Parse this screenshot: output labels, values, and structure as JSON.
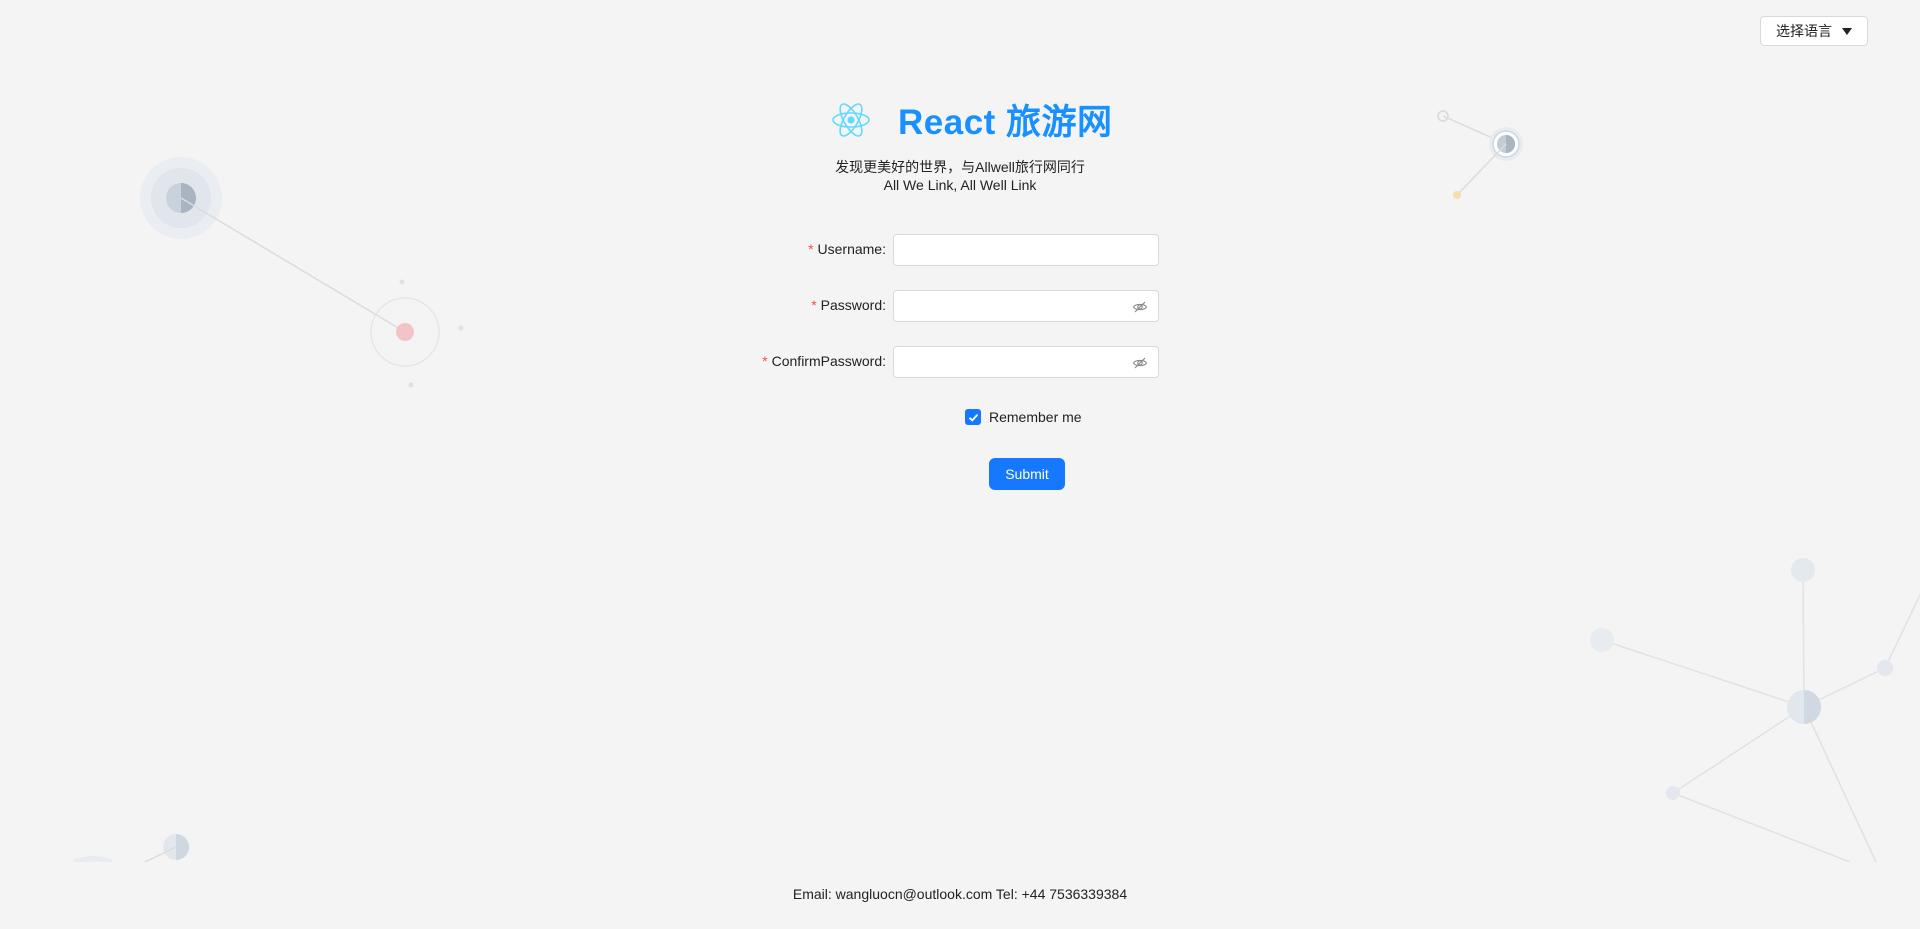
{
  "language_selector": {
    "label": "选择语言"
  },
  "header": {
    "logo": "react-atom-icon",
    "title": "React 旅游网",
    "slogan_cn": "发现更美好的世界，与Allwell旅行网同行",
    "slogan_en": "All We Link, All Well Link"
  },
  "form": {
    "username": {
      "label": "Username",
      "value": "",
      "placeholder": ""
    },
    "password": {
      "label": "Password",
      "value": "",
      "placeholder": ""
    },
    "confirm_password": {
      "label": "ConfirmPassword",
      "value": "",
      "placeholder": ""
    },
    "remember": {
      "label": "Remember me",
      "checked": true
    },
    "submit_label": "Submit"
  },
  "footer": {
    "text": "Email: wangluocn@outlook.com Tel: +44 7536339384"
  },
  "colors": {
    "primary": "#1677ff",
    "brand_title": "#1890ff",
    "required": "#ff4d4f",
    "background": "#f4f4f4"
  }
}
